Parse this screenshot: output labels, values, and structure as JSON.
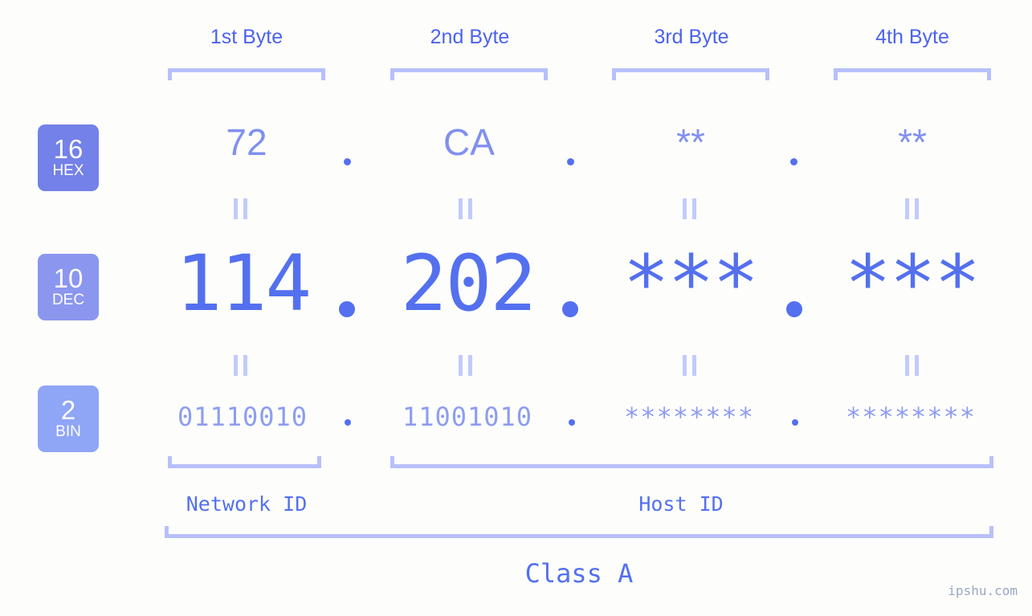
{
  "watermark": "ipshu.com",
  "columns": [
    {
      "header": "1st Byte"
    },
    {
      "header": "2nd Byte"
    },
    {
      "header": "3rd Byte"
    },
    {
      "header": "4th Byte"
    }
  ],
  "bases": [
    {
      "number": "16",
      "name": "HEX",
      "color": "#7381e8"
    },
    {
      "number": "10",
      "name": "DEC",
      "color": "#8b96ef"
    },
    {
      "number": "2",
      "name": "BIN",
      "color": "#8fa5f5"
    }
  ],
  "rows": {
    "hex": {
      "values": [
        "72",
        "CA",
        "**",
        "**"
      ]
    },
    "dec": {
      "values": [
        "114",
        "202",
        "***",
        "***"
      ]
    },
    "bin": {
      "values": [
        "01110010",
        "11001010",
        "********",
        "********"
      ]
    }
  },
  "separators": {
    "glyph": "."
  },
  "equality": {
    "glyph": "||"
  },
  "ids": {
    "network": "Network ID",
    "host": "Host ID"
  },
  "class": {
    "label": "Class A"
  },
  "colors": {
    "background": "#fdfefb",
    "primary": "#5470ef",
    "light": "#8e9df0",
    "bracket": "#b7c0fb",
    "equality": "#c2cafc",
    "watermark": "#9aa6c4"
  }
}
